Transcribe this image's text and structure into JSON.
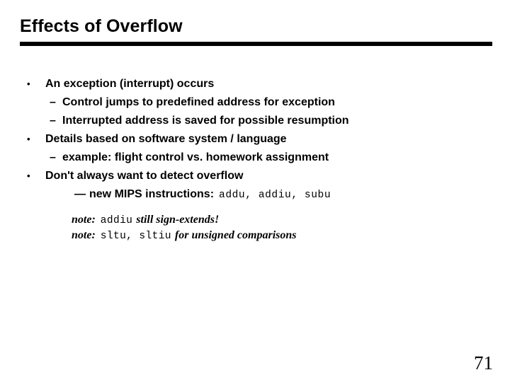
{
  "slide": {
    "title": "Effects of Overflow",
    "page_number": "71",
    "bullets": [
      {
        "level": 1,
        "marker": "•",
        "text": "An exception (interrupt) occurs"
      },
      {
        "level": 2,
        "marker": "–",
        "text": "Control jumps to predefined address for exception"
      },
      {
        "level": 2,
        "marker": "–",
        "text": "Interrupted address is saved for possible resumption"
      },
      {
        "level": 1,
        "marker": "•",
        "text": "Details based on software system / language"
      },
      {
        "level": 2,
        "marker": "–",
        "text": "example:  flight control vs. homework assignment"
      },
      {
        "level": 1,
        "marker": "•",
        "text": "Don't always want to detect overflow"
      },
      {
        "level": 3,
        "marker": "—",
        "text": "new MIPS instructions:",
        "mono_suffix": "addu, addiu, subu"
      }
    ],
    "notes": [
      {
        "label": "note:",
        "mono": "addiu",
        "tail": "still sign-extends!"
      },
      {
        "label": "note:",
        "mono": "sltu, sltiu",
        "tail": "for unsigned comparisons"
      }
    ]
  }
}
